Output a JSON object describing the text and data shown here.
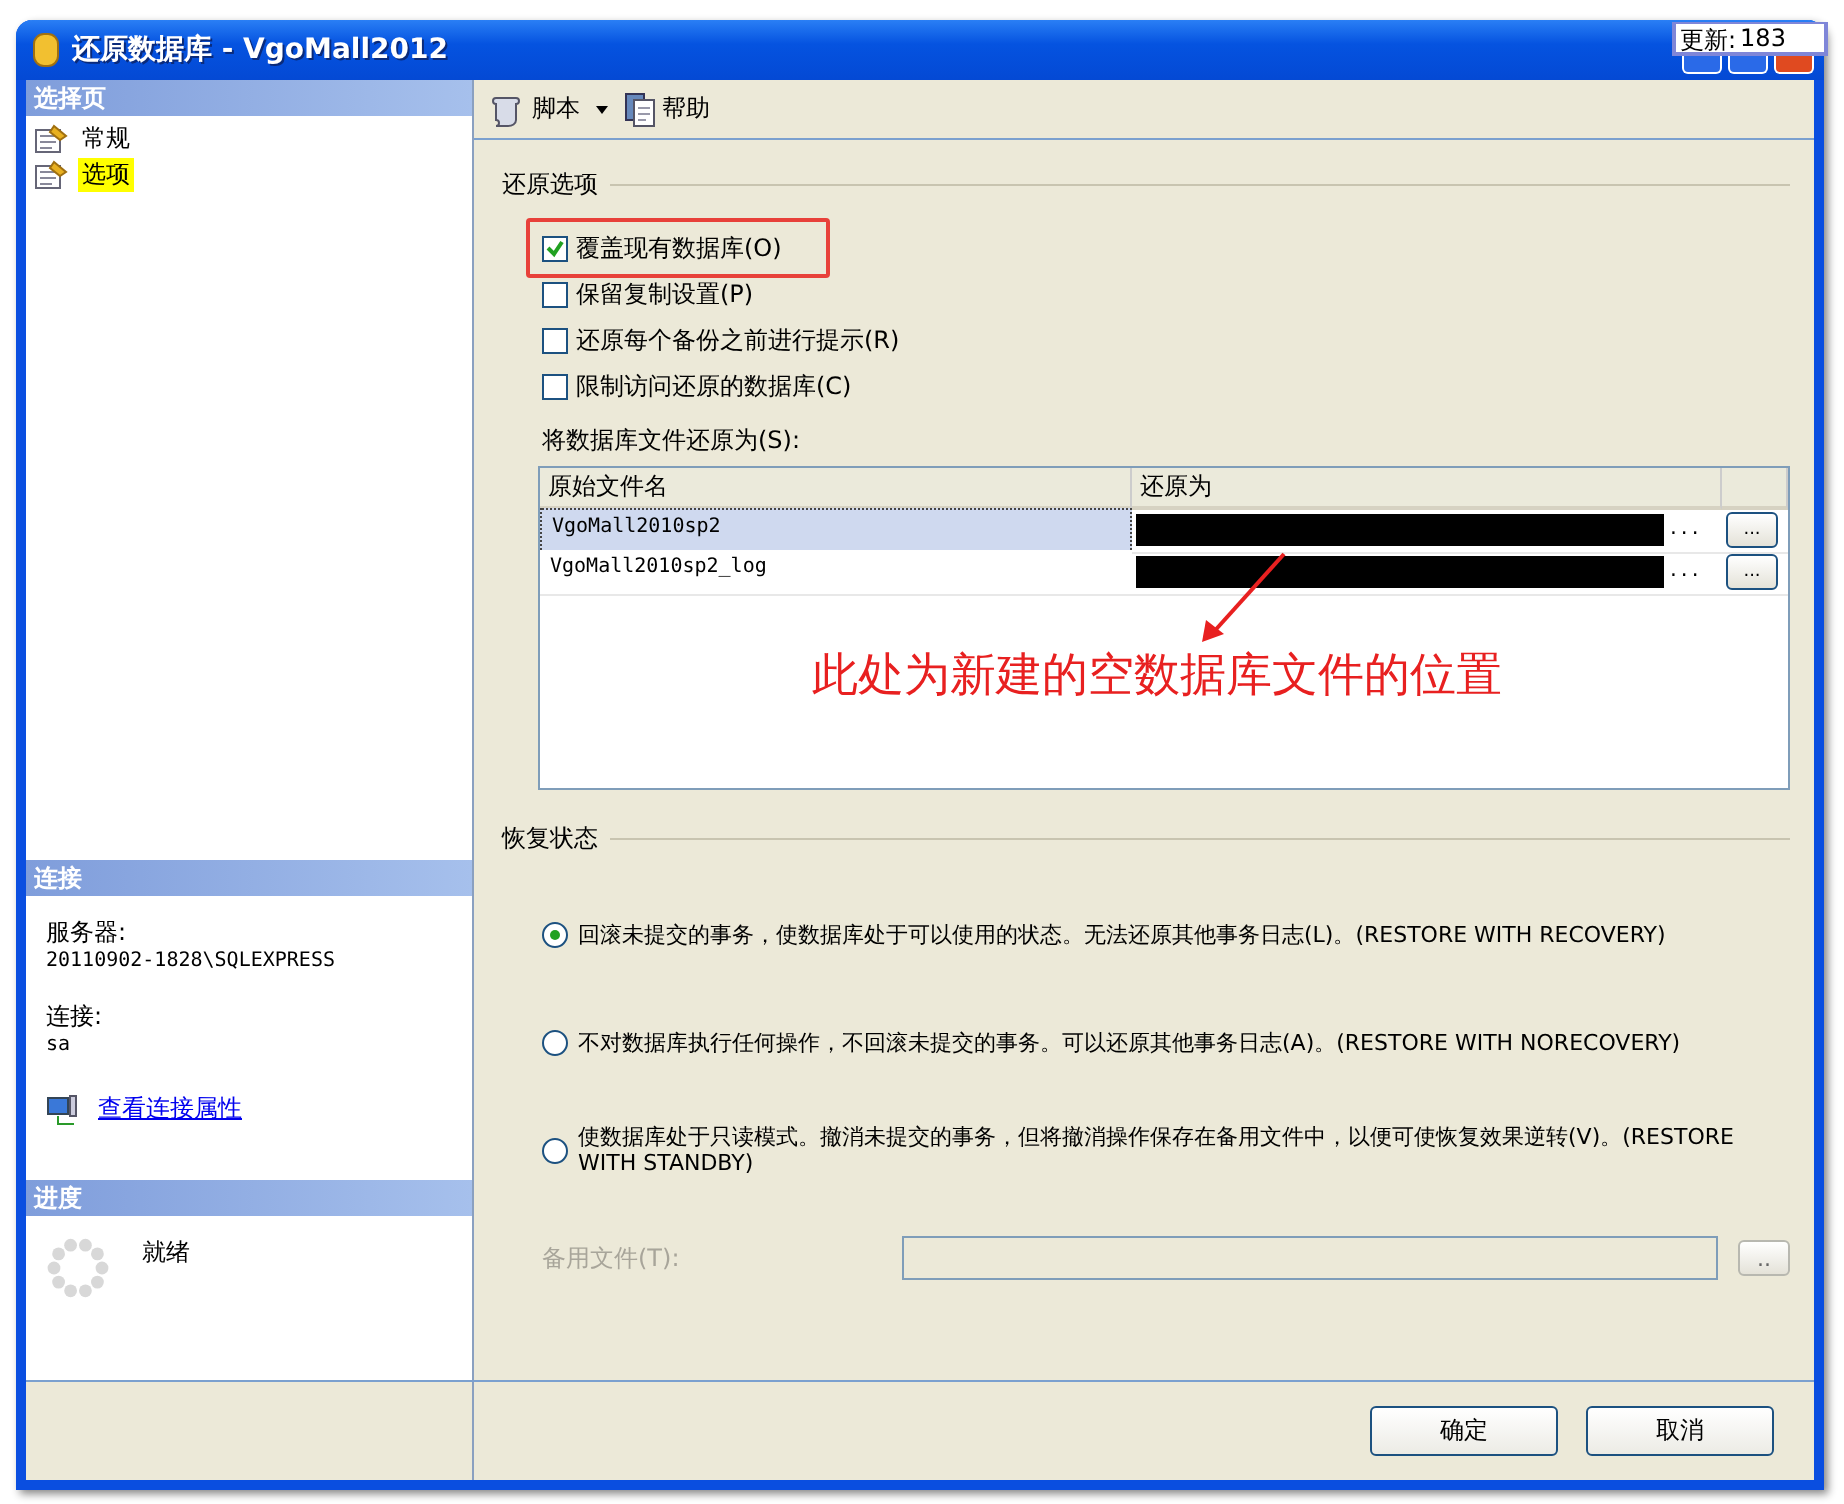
{
  "window": {
    "title": "还原数据库 - VgoMall2012"
  },
  "update_popup": {
    "label": "更新:",
    "value": "183"
  },
  "sidebar": {
    "header": "选择页",
    "items": [
      {
        "label": "常规",
        "selected": false
      },
      {
        "label": "选项",
        "selected": true
      }
    ]
  },
  "connection": {
    "header": "连接",
    "server_label": "服务器:",
    "server": "20110902-1828\\SQLEXPRESS",
    "login_label": "连接:",
    "login": "sa",
    "link": "查看连接属性"
  },
  "progress": {
    "header": "进度",
    "status": "就绪"
  },
  "toolbar": {
    "items": [
      {
        "label": "脚本",
        "kind": "script"
      },
      {
        "label": "帮助",
        "kind": "help"
      }
    ]
  },
  "restore_options": {
    "title": "还原选项",
    "checkboxes": [
      {
        "label": "覆盖现有数据库(O)",
        "checked": true
      },
      {
        "label": "保留复制设置(P)",
        "checked": false
      },
      {
        "label": "还原每个备份之前进行提示(R)",
        "checked": false
      },
      {
        "label": "限制访问还原的数据库(C)",
        "checked": false
      }
    ],
    "files_label": "将数据库文件还原为(S):",
    "table": {
      "columns": [
        "原始文件名",
        "还原为"
      ],
      "rows": [
        {
          "file": "VgoMall2010sp2",
          "selected": true,
          "path_suffix": "...",
          "browse": "..."
        },
        {
          "file": "VgoMall2010sp2_log",
          "selected": false,
          "path_suffix": "...",
          "browse": "..."
        }
      ]
    }
  },
  "annotation": {
    "text": "此处为新建的空数据库文件的位置"
  },
  "recovery_state": {
    "title": "恢复状态",
    "options": [
      {
        "label": "回滚未提交的事务，使数据库处于可以使用的状态。无法还原其他事务日志(L)。(RESTORE WITH RECOVERY)",
        "selected": true
      },
      {
        "label": "不对数据库执行任何操作，不回滚未提交的事务。可以还原其他事务日志(A)。(RESTORE WITH NORECOVERY)",
        "selected": false
      },
      {
        "label": "使数据库处于只读模式。撤消未提交的事务，但将撤消操作保存在备用文件中，以便可使恢复效果逆转(V)。(RESTORE WITH STANDBY)",
        "selected": false
      }
    ],
    "standby_label": "备用文件(T):",
    "standby_browse": ".."
  },
  "buttons": [
    "确定",
    "取消"
  ]
}
